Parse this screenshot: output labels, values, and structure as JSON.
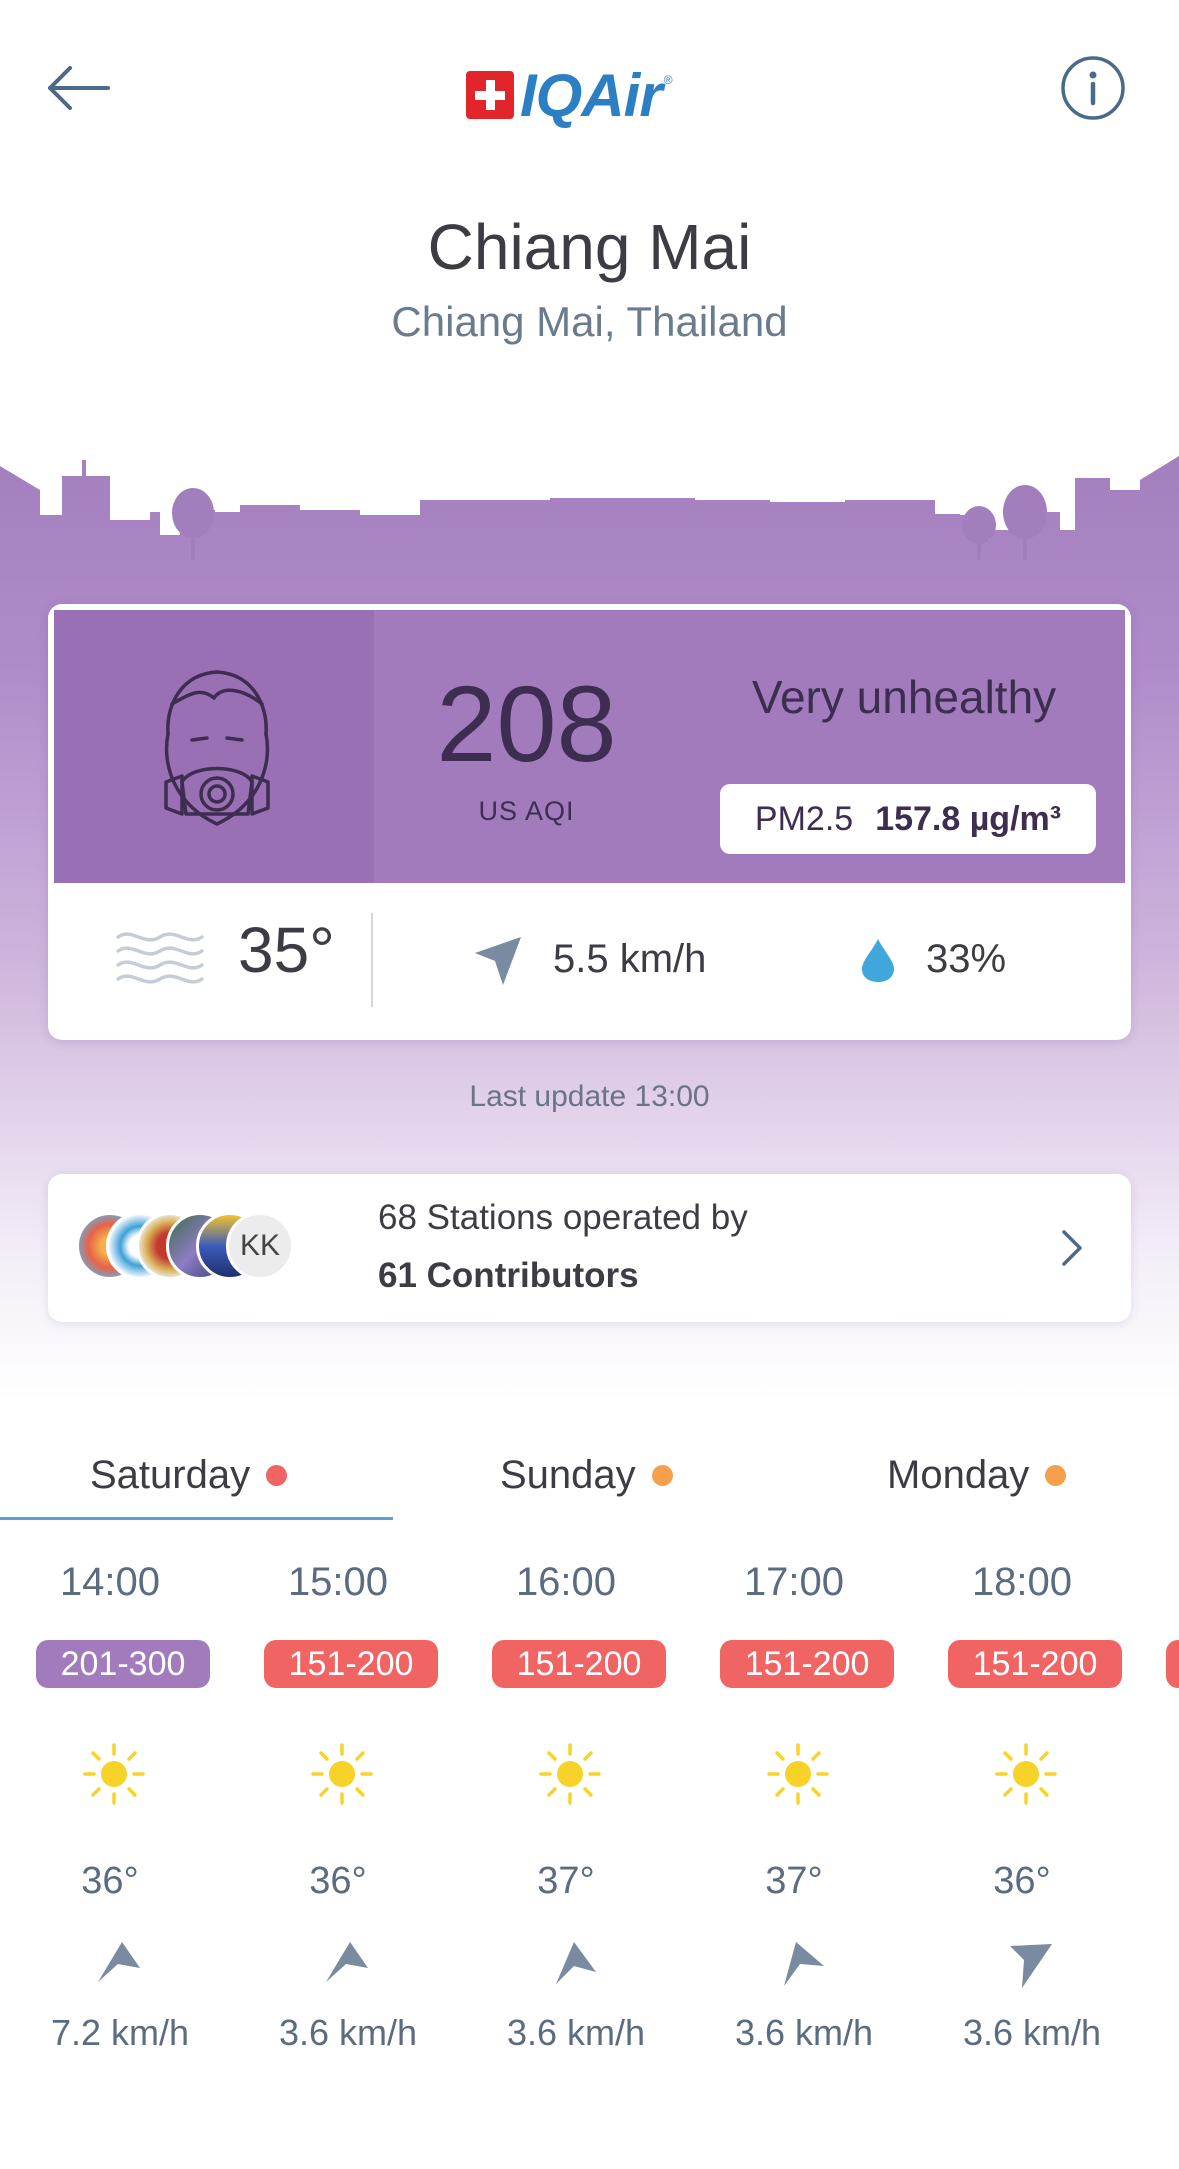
{
  "header": {
    "brand": "IQAir"
  },
  "location": {
    "city": "Chiang Mai",
    "region": "Chiang Mai, Thailand"
  },
  "aqi": {
    "value": "208",
    "unit": "US AQI",
    "status": "Very unhealthy",
    "pollutant": "PM2.5",
    "concentration": "157.8 µg/m³",
    "color": "#a27bbd"
  },
  "weather": {
    "temperature": "35°",
    "wind": "5.5 km/h",
    "humidity": "33%"
  },
  "last_update": "Last update 13:00",
  "stations": {
    "line1": "68 Stations operated by",
    "line2": "61 Contributors",
    "avatar_initials": "KK"
  },
  "tabs": [
    {
      "label": "Saturday",
      "dot_color": "#f06564"
    },
    {
      "label": "Sunday",
      "dot_color": "#f6a04b"
    },
    {
      "label": "Monday",
      "dot_color": "#f6a04b"
    }
  ],
  "hourly": [
    {
      "time": "14:00",
      "range": "201-300",
      "range_color": "#a27bbd",
      "temp": "36°",
      "wind": "7.2 km/h",
      "icon": "sun-icon"
    },
    {
      "time": "15:00",
      "range": "151-200",
      "range_color": "#f06564",
      "temp": "36°",
      "wind": "3.6 km/h",
      "icon": "sun-icon"
    },
    {
      "time": "16:00",
      "range": "151-200",
      "range_color": "#f06564",
      "temp": "37°",
      "wind": "3.6 km/h",
      "icon": "sun-icon"
    },
    {
      "time": "17:00",
      "range": "151-200",
      "range_color": "#f06564",
      "temp": "37°",
      "wind": "3.6 km/h",
      "icon": "sun-icon"
    },
    {
      "time": "18:00",
      "range": "151-200",
      "range_color": "#f06564",
      "temp": "36°",
      "wind": "3.6 km/h",
      "icon": "sun-icon"
    }
  ]
}
